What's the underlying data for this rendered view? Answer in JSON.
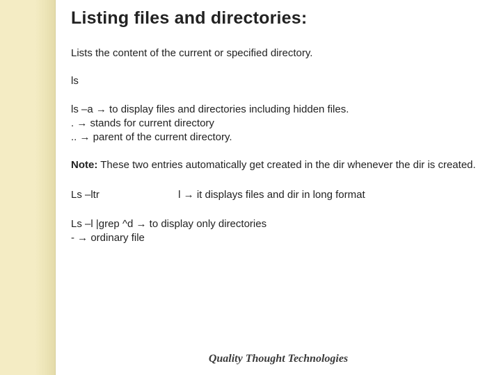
{
  "slide": {
    "title": "Listing files and directories:",
    "intro": "Lists the content of the current or specified directory.",
    "cmd_plain": "ls",
    "line_ls_a_pre": "ls –a ",
    "line_ls_a_post": " to  display files and directories including hidden files.",
    "line_dot_pre": ". ",
    "line_dot_post": " stands for current directory",
    "line_dotdot_pre": ".. ",
    "line_dotdot_post": " parent of the current directory.",
    "note_label": "Note:",
    "note_text": " These two entries automatically get created in the dir whenever the dir is created.",
    "ltr_cmd": "Ls –ltr",
    "ltr_l_pre": "l ",
    "ltr_l_post": " it displays files and dir in long format",
    "grep_pre": "Ls –l |grep ^d ",
    "grep_post": " to display only directories",
    "dash_pre": "- ",
    "dash_post": " ordinary file",
    "arrow": "→"
  },
  "footer": {
    "text": "Quality Thought Technologies"
  }
}
